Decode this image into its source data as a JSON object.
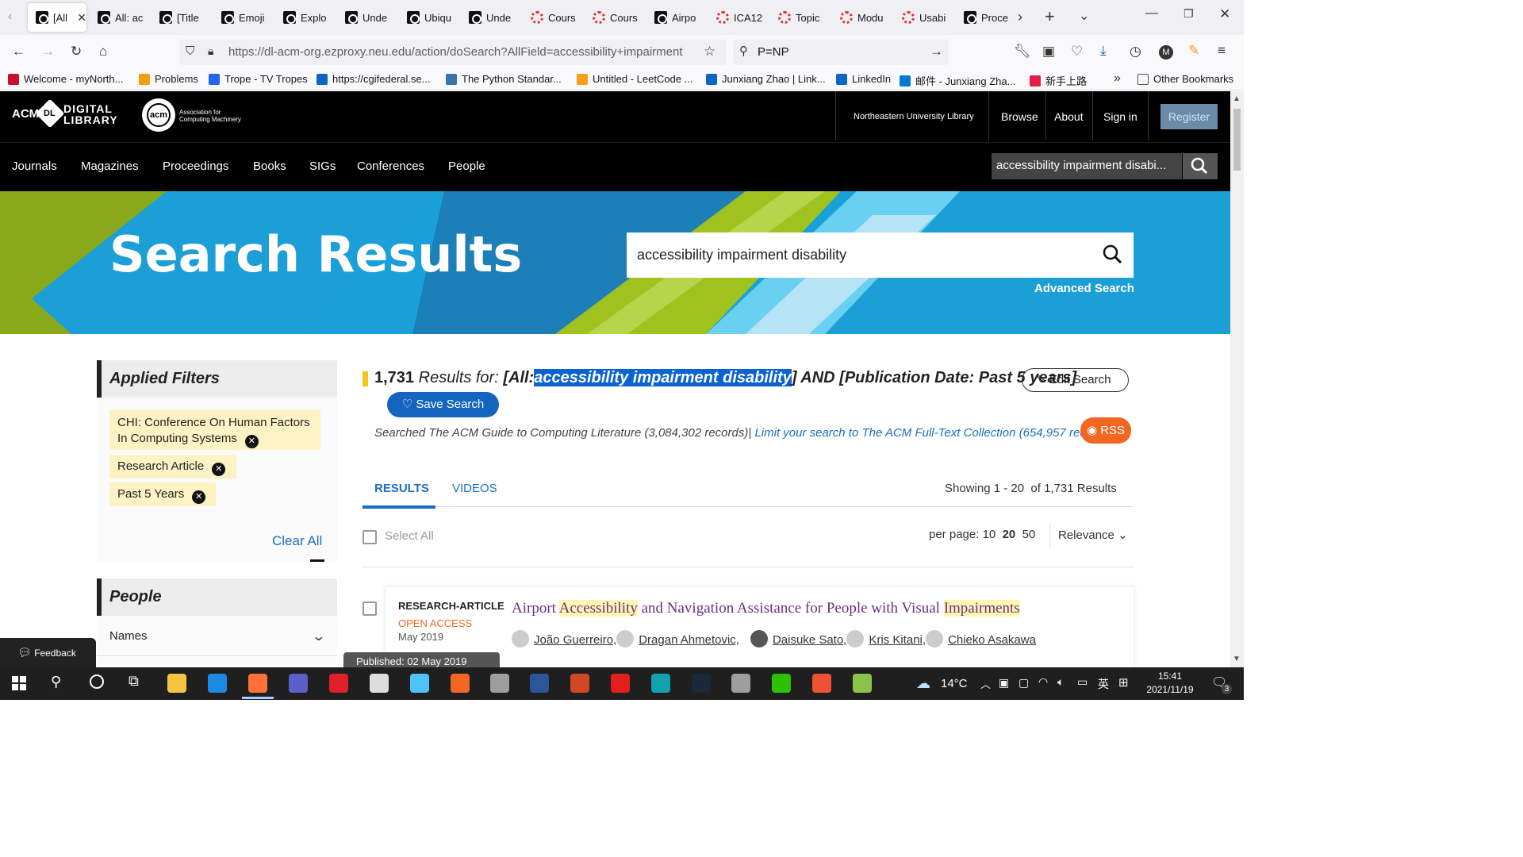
{
  "browser": {
    "tabs": [
      {
        "label": "[All",
        "icon": "acm"
      },
      {
        "label": "All: ac",
        "icon": "acm"
      },
      {
        "label": "[Title",
        "icon": "acm"
      },
      {
        "label": "Emoji",
        "icon": "acm"
      },
      {
        "label": "Explo",
        "icon": "acm"
      },
      {
        "label": "Unde",
        "icon": "acm"
      },
      {
        "label": "Ubiqu",
        "icon": "acm"
      },
      {
        "label": "Unde",
        "icon": "acm"
      },
      {
        "label": "Cours",
        "icon": "ring"
      },
      {
        "label": "Cours",
        "icon": "ring"
      },
      {
        "label": "Airpo",
        "icon": "acm"
      },
      {
        "label": "ICA12",
        "icon": "ring"
      },
      {
        "label": "Topic",
        "icon": "ring"
      },
      {
        "label": "Modu",
        "icon": "ring"
      },
      {
        "label": "Usabi",
        "icon": "ring"
      },
      {
        "label": "Proce",
        "icon": "acm"
      }
    ],
    "url": "https://dl-acm-org.ezproxy.neu.edu/action/doSearch?AllField=accessibility+impairment",
    "search_value": "P=NP",
    "bookmarks": [
      {
        "label": "Welcome - myNorth...",
        "color": "#c8102e"
      },
      {
        "label": "Problems",
        "color": "#f59e0b"
      },
      {
        "label": "Trope - TV Tropes",
        "color": "#2563eb"
      },
      {
        "label": "https://cgifederal.se...",
        "color": "#0b66c3"
      },
      {
        "label": "The Python Standar...",
        "color": "#3776ab"
      },
      {
        "label": "Untitled - LeetCode ...",
        "color": "#f89f1b"
      },
      {
        "label": "Junxiang Zhao | Link...",
        "color": "#0a66c2"
      },
      {
        "label": "LinkedIn",
        "color": "#0a66c2"
      },
      {
        "label": "邮件 - Junxiang Zha...",
        "color": "#0078d4"
      },
      {
        "label": "新手上路",
        "color": "#e11d48"
      }
    ],
    "other_bookmarks": "Other Bookmarks",
    "profile_initial": "M"
  },
  "acm": {
    "logo_acm": "ACM",
    "logo_dl_line1": "DIGITAL",
    "logo_dl_line2": "LIBRARY",
    "assoc_line1": "Association for",
    "assoc_line2": "Computing Machinery",
    "acm_badge": "acm",
    "institution": "Northeastern University Library",
    "top_links": [
      "Browse",
      "About",
      "Sign in"
    ],
    "register": "Register",
    "nav": [
      "Journals",
      "Magazines",
      "Proceedings",
      "Books",
      "SIGs",
      "Conferences",
      "People"
    ],
    "header_search": "accessibility impairment disabi..."
  },
  "banner": {
    "title": "Search Results",
    "search_value": "accessibility impairment disability",
    "advanced": "Advanced Search"
  },
  "filters": {
    "heading": "Applied Filters",
    "chips": [
      {
        "line1": "CHI: Conference On Human Factors",
        "line2": "In Computing Systems"
      },
      {
        "line1": "Research Article",
        "line2": ""
      },
      {
        "line1": "Past 5 Years",
        "line2": ""
      }
    ],
    "clear_all": "Clear All",
    "people_heading": "People",
    "names": "Names"
  },
  "results": {
    "count": "1,731",
    "results_for": "Results for:",
    "query_pre": "[All:",
    "query_term": "accessibility impairment disability",
    "query_post": "] AND [Publication Date: Past 5 years]",
    "edit_search": "Edit Search",
    "save_search": "Save Search",
    "searched": "Searched The ACM Guide to Computing Literature (3,084,302 records)|",
    "limit_link": "Limit your search to The ACM Full-Text Collection (654,957 records)",
    "rss": "RSS",
    "tabs": [
      "RESULTS",
      "VIDEOS"
    ],
    "showing": "Showing 1 - 20  of 1,731 Results",
    "select_all": "Select All",
    "per_page_label": "per page:",
    "per_page": [
      "10",
      "20",
      "50"
    ],
    "sort": "Relevance",
    "items": [
      {
        "type": "RESEARCH-ARTICLE",
        "access": "OPEN ACCESS",
        "date": "May 2019",
        "title_parts": [
          "Airport ",
          "Accessibility",
          " and Navigation Assistance for People with Visual ",
          "Impairments"
        ],
        "authors": [
          "João Guerreiro,",
          "Dragan Ahmetovic,",
          "Daisuke Sato,",
          "Kris Kitani,",
          "Chieko Asakawa"
        ],
        "tooltip": "Published: 02 May 2019"
      }
    ]
  },
  "feedback": "Feedback",
  "taskbar": {
    "weather": "14°C",
    "ime": "英",
    "time": "15:41",
    "date": "2021/11/19",
    "notif": "3"
  }
}
